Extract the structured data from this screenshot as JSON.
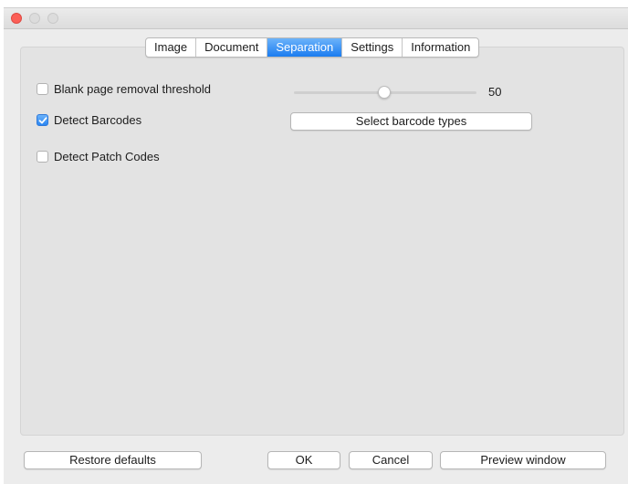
{
  "window": {
    "controls": [
      "close",
      "minimize",
      "maximize"
    ]
  },
  "tabs": [
    {
      "label": "Image",
      "active": false
    },
    {
      "label": "Document",
      "active": false
    },
    {
      "label": "Separation",
      "active": true
    },
    {
      "label": "Settings",
      "active": false
    },
    {
      "label": "Information",
      "active": false
    }
  ],
  "separation": {
    "blank_page": {
      "label": "Blank page removal threshold",
      "checked": false,
      "slider_value": "50",
      "slider_fraction": 0.5
    },
    "barcodes": {
      "label": "Detect Barcodes",
      "checked": true,
      "button_label": "Select barcode types"
    },
    "patch_codes": {
      "label": "Detect Patch Codes",
      "checked": false
    }
  },
  "footer": {
    "restore_label": "Restore defaults",
    "ok_label": "OK",
    "cancel_label": "Cancel",
    "preview_label": "Preview window"
  },
  "colors": {
    "accent": "#1b7cf0",
    "close_button": "#fc5f57",
    "window_bg": "#ececec",
    "panel_bg": "#e3e3e3"
  }
}
